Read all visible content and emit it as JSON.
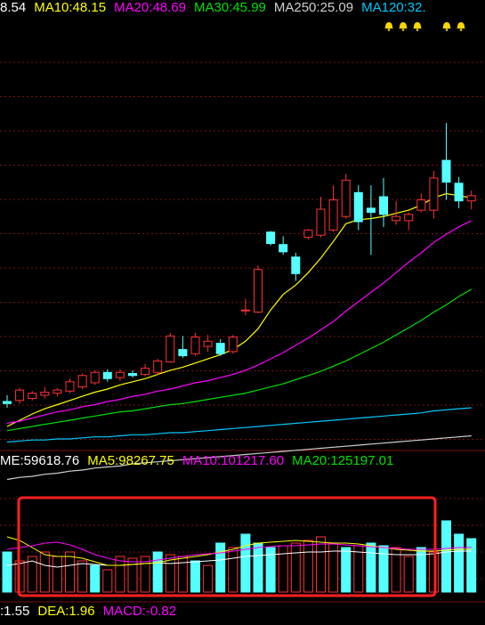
{
  "theme": {
    "background": "#000000",
    "up_color": "#ff3232",
    "down_color": "#54ffff",
    "grid_color": "#7a1010",
    "highlight_box_color": "#ff2020"
  },
  "price_legend": [
    {
      "label": "8.54",
      "color": "#ffffff"
    },
    {
      "label": "MA10:48.15",
      "color": "#ffff00"
    },
    {
      "label": "MA20:48.69",
      "color": "#ff00ff"
    },
    {
      "label": "MA30:45.99",
      "color": "#00e000"
    },
    {
      "label": "MA250:25.09",
      "color": "#d0d0d0"
    },
    {
      "label": "MA120:32.",
      "color": "#00c8ff"
    }
  ],
  "volume_legend": [
    {
      "label": "ME:59618.76",
      "color": "#ffffff"
    },
    {
      "label": "MA5:98267.75",
      "color": "#ffff00"
    },
    {
      "label": "MA10:101217.60",
      "color": "#ff00ff"
    },
    {
      "label": "MA20:125197.01",
      "color": "#00e000"
    }
  ],
  "macd_legend": [
    {
      "label": ":1.55",
      "color": "#ffffff"
    },
    {
      "label": "DEA:1.96",
      "color": "#ffff00"
    },
    {
      "label": "MACD:-0.82",
      "color": "#ff00ff"
    }
  ],
  "event_markers": [
    "bell-icon",
    "bell-icon",
    "bell-icon",
    "bell-icon",
    "bell-icon"
  ],
  "chart_data": {
    "type": "candlestick",
    "title": "",
    "price_scale": {
      "min": 22,
      "max": 62
    },
    "candles": [
      {
        "o": 26.2,
        "h": 26.8,
        "l": 25.6,
        "c": 26.0
      },
      {
        "o": 26.3,
        "h": 27.5,
        "l": 26.0,
        "c": 27.3
      },
      {
        "o": 26.5,
        "h": 27.2,
        "l": 26.3,
        "c": 27.0
      },
      {
        "o": 26.8,
        "h": 27.6,
        "l": 26.5,
        "c": 27.1
      },
      {
        "o": 27.0,
        "h": 27.5,
        "l": 26.7,
        "c": 27.3
      },
      {
        "o": 27.2,
        "h": 28.4,
        "l": 27.0,
        "c": 28.1
      },
      {
        "o": 27.6,
        "h": 28.9,
        "l": 27.4,
        "c": 28.7
      },
      {
        "o": 28.0,
        "h": 29.2,
        "l": 27.8,
        "c": 29.0
      },
      {
        "o": 29.0,
        "h": 29.3,
        "l": 28.1,
        "c": 28.4
      },
      {
        "o": 28.5,
        "h": 29.3,
        "l": 28.2,
        "c": 29.0
      },
      {
        "o": 28.9,
        "h": 29.2,
        "l": 28.5,
        "c": 28.7
      },
      {
        "o": 28.8,
        "h": 29.8,
        "l": 28.6,
        "c": 29.4
      },
      {
        "o": 29.0,
        "h": 30.3,
        "l": 28.8,
        "c": 30.1
      },
      {
        "o": 30.0,
        "h": 32.8,
        "l": 29.9,
        "c": 32.5
      },
      {
        "o": 31.2,
        "h": 32.5,
        "l": 30.4,
        "c": 30.6
      },
      {
        "o": 30.8,
        "h": 32.8,
        "l": 30.6,
        "c": 32.4
      },
      {
        "o": 31.5,
        "h": 32.6,
        "l": 31.0,
        "c": 32.0
      },
      {
        "o": 31.8,
        "h": 32.2,
        "l": 30.6,
        "c": 30.8
      },
      {
        "o": 31.0,
        "h": 32.6,
        "l": 30.8,
        "c": 32.4
      },
      {
        "o": 35.0,
        "h": 36.1,
        "l": 34.5,
        "c": 35.0
      },
      {
        "o": 34.8,
        "h": 39.3,
        "l": 34.7,
        "c": 38.9
      },
      {
        "o": 42.5,
        "h": 42.6,
        "l": 41.2,
        "c": 41.4
      },
      {
        "o": 41.3,
        "h": 42.1,
        "l": 40.3,
        "c": 40.6
      },
      {
        "o": 40.1,
        "h": 40.5,
        "l": 37.8,
        "c": 38.5
      },
      {
        "o": 42.0,
        "h": 42.8,
        "l": 41.8,
        "c": 42.7
      },
      {
        "o": 42.2,
        "h": 45.9,
        "l": 42.0,
        "c": 44.7
      },
      {
        "o": 42.7,
        "h": 47.0,
        "l": 42.5,
        "c": 45.6
      },
      {
        "o": 44.0,
        "h": 48.1,
        "l": 43.8,
        "c": 47.5
      },
      {
        "o": 46.3,
        "h": 47.0,
        "l": 42.7,
        "c": 43.5
      },
      {
        "o": 44.8,
        "h": 47.0,
        "l": 40.3,
        "c": 44.4
      },
      {
        "o": 45.9,
        "h": 47.7,
        "l": 43.0,
        "c": 44.2
      },
      {
        "o": 43.6,
        "h": 45.5,
        "l": 43.2,
        "c": 44.0
      },
      {
        "o": 43.6,
        "h": 44.4,
        "l": 42.7,
        "c": 44.2
      },
      {
        "o": 44.6,
        "h": 46.2,
        "l": 44.4,
        "c": 45.6
      },
      {
        "o": 44.6,
        "h": 48.4,
        "l": 43.8,
        "c": 47.7
      },
      {
        "o": 49.4,
        "h": 53.0,
        "l": 45.6,
        "c": 47.3
      },
      {
        "o": 47.2,
        "h": 47.8,
        "l": 44.8,
        "c": 45.5
      },
      {
        "o": 45.5,
        "h": 46.5,
        "l": 44.7,
        "c": 46.0
      }
    ],
    "ma_lines": [
      {
        "name": "MA10",
        "color": "#ffff00",
        "values": [
          23.8,
          24.4,
          25.0,
          25.5,
          25.9,
          26.3,
          26.7,
          27.1,
          27.4,
          27.8,
          28.1,
          28.4,
          28.8,
          29.2,
          29.5,
          29.9,
          30.3,
          30.7,
          31.2,
          32.0,
          33.2,
          35.0,
          36.5,
          37.4,
          38.6,
          40.0,
          41.6,
          43.3,
          43.7,
          43.8,
          44.0,
          44.3,
          44.6,
          45.1,
          45.8,
          46.2,
          46.0,
          45.8
        ]
      },
      {
        "name": "MA20",
        "color": "#ff00ff",
        "values": [
          24.1,
          24.3,
          24.6,
          24.9,
          25.2,
          25.4,
          25.7,
          25.9,
          26.2,
          26.4,
          26.7,
          26.9,
          27.2,
          27.4,
          27.7,
          28.0,
          28.2,
          28.5,
          28.8,
          29.2,
          29.7,
          30.3,
          30.9,
          31.6,
          32.3,
          33.1,
          33.9,
          34.9,
          35.8,
          36.7,
          37.6,
          38.6,
          39.6,
          40.5,
          41.5,
          42.3,
          43.0,
          43.6
        ]
      },
      {
        "name": "MA30",
        "color": "#00e000",
        "values": [
          23.4,
          23.6,
          23.8,
          24.0,
          24.2,
          24.4,
          24.6,
          24.8,
          25.0,
          25.2,
          25.3,
          25.5,
          25.7,
          25.9,
          26.0,
          26.2,
          26.4,
          26.6,
          26.8,
          27.0,
          27.3,
          27.6,
          27.9,
          28.3,
          28.7,
          29.1,
          29.6,
          30.1,
          30.7,
          31.3,
          31.9,
          32.6,
          33.3,
          34.0,
          34.8,
          35.5,
          36.3,
          37.0
        ]
      },
      {
        "name": "MA120",
        "color": "#00c8ff",
        "values": [
          22.3,
          22.4,
          22.5,
          22.5,
          22.6,
          22.6,
          22.7,
          22.8,
          22.8,
          22.9,
          23.0,
          23.0,
          23.1,
          23.2,
          23.2,
          23.3,
          23.4,
          23.5,
          23.6,
          23.7,
          23.8,
          23.9,
          24.0,
          24.1,
          24.2,
          24.3,
          24.4,
          24.5,
          24.6,
          24.7,
          24.8,
          24.9,
          25.0,
          25.1,
          25.3,
          25.4,
          25.5,
          25.6
        ]
      },
      {
        "name": "MA250",
        "color": "#d0d0d0",
        "values": [
          18.7,
          18.9,
          19.0,
          19.2,
          19.3,
          19.5,
          19.6,
          19.8,
          19.9,
          20.0,
          20.2,
          20.3,
          20.4,
          20.5,
          20.6,
          20.7,
          20.8,
          20.9,
          21.0,
          21.1,
          21.2,
          21.3,
          21.4,
          21.5,
          21.6,
          21.7,
          21.8,
          21.9,
          22.0,
          22.1,
          22.2,
          22.3,
          22.4,
          22.5,
          22.6,
          22.7,
          22.8,
          22.9
        ]
      }
    ],
    "bottom_panel": {
      "bars": [
        {
          "v": 0.45,
          "up": false
        },
        {
          "v": 0.35,
          "up": true
        },
        {
          "v": 0.4,
          "up": true
        },
        {
          "v": 0.45,
          "up": true
        },
        {
          "v": 0.4,
          "up": true
        },
        {
          "v": 0.45,
          "up": true
        },
        {
          "v": 0.35,
          "up": true
        },
        {
          "v": 0.3,
          "up": false
        },
        {
          "v": 0.25,
          "up": true
        },
        {
          "v": 0.4,
          "up": true
        },
        {
          "v": 0.38,
          "up": true
        },
        {
          "v": 0.4,
          "up": true
        },
        {
          "v": 0.45,
          "up": false
        },
        {
          "v": 0.42,
          "up": true
        },
        {
          "v": 0.4,
          "up": true
        },
        {
          "v": 0.35,
          "up": false
        },
        {
          "v": 0.3,
          "up": true
        },
        {
          "v": 0.55,
          "up": false
        },
        {
          "v": 0.5,
          "up": true
        },
        {
          "v": 0.65,
          "up": false
        },
        {
          "v": 0.55,
          "up": false
        },
        {
          "v": 0.5,
          "up": false
        },
        {
          "v": 0.52,
          "up": true
        },
        {
          "v": 0.55,
          "up": true
        },
        {
          "v": 0.58,
          "up": true
        },
        {
          "v": 0.62,
          "up": true
        },
        {
          "v": 0.55,
          "up": true
        },
        {
          "v": 0.5,
          "up": false
        },
        {
          "v": 0.52,
          "up": true
        },
        {
          "v": 0.55,
          "up": false
        },
        {
          "v": 0.52,
          "up": false
        },
        {
          "v": 0.5,
          "up": true
        },
        {
          "v": 0.4,
          "up": true
        },
        {
          "v": 0.5,
          "up": false
        },
        {
          "v": 0.45,
          "up": true
        },
        {
          "v": 0.8,
          "up": false
        },
        {
          "v": 0.65,
          "up": false
        },
        {
          "v": 0.6,
          "up": false
        }
      ],
      "lines": [
        {
          "name": "DIF",
          "color": "#ffffff",
          "values": [
            0.3,
            0.32,
            0.35,
            0.3,
            0.28,
            0.3,
            0.32,
            0.31,
            0.3,
            0.3,
            0.31,
            0.32,
            0.33,
            0.32,
            0.33,
            0.34,
            0.35,
            0.36,
            0.38,
            0.4,
            0.41,
            0.42,
            0.43,
            0.44,
            0.45,
            0.45,
            0.46,
            0.46,
            0.45,
            0.44,
            0.43,
            0.42,
            0.42,
            0.42,
            0.43,
            0.45,
            0.46,
            0.46
          ]
        },
        {
          "name": "DEA",
          "color": "#ffff00",
          "values": [
            0.62,
            0.58,
            0.5,
            0.42,
            0.4,
            0.4,
            0.38,
            0.34,
            0.3,
            0.3,
            0.31,
            0.32,
            0.33,
            0.36,
            0.38,
            0.4,
            0.42,
            0.45,
            0.48,
            0.52,
            0.55,
            0.56,
            0.57,
            0.58,
            0.57,
            0.56,
            0.55,
            0.55,
            0.54,
            0.52,
            0.5,
            0.48,
            0.47,
            0.46,
            0.46,
            0.47,
            0.48,
            0.48
          ]
        },
        {
          "name": "MACD",
          "color": "#ff00ff",
          "values": [
            0.48,
            0.5,
            0.52,
            0.55,
            0.56,
            0.53,
            0.48,
            0.42,
            0.38,
            0.35,
            0.34,
            0.34,
            0.36,
            0.38,
            0.4,
            0.42,
            0.43,
            0.44,
            0.46,
            0.48,
            0.5,
            0.51,
            0.52,
            0.52,
            0.53,
            0.54,
            0.54,
            0.53,
            0.52,
            0.51,
            0.5,
            0.49,
            0.48,
            0.48,
            0.48,
            0.49,
            0.5,
            0.5
          ]
        }
      ]
    }
  }
}
